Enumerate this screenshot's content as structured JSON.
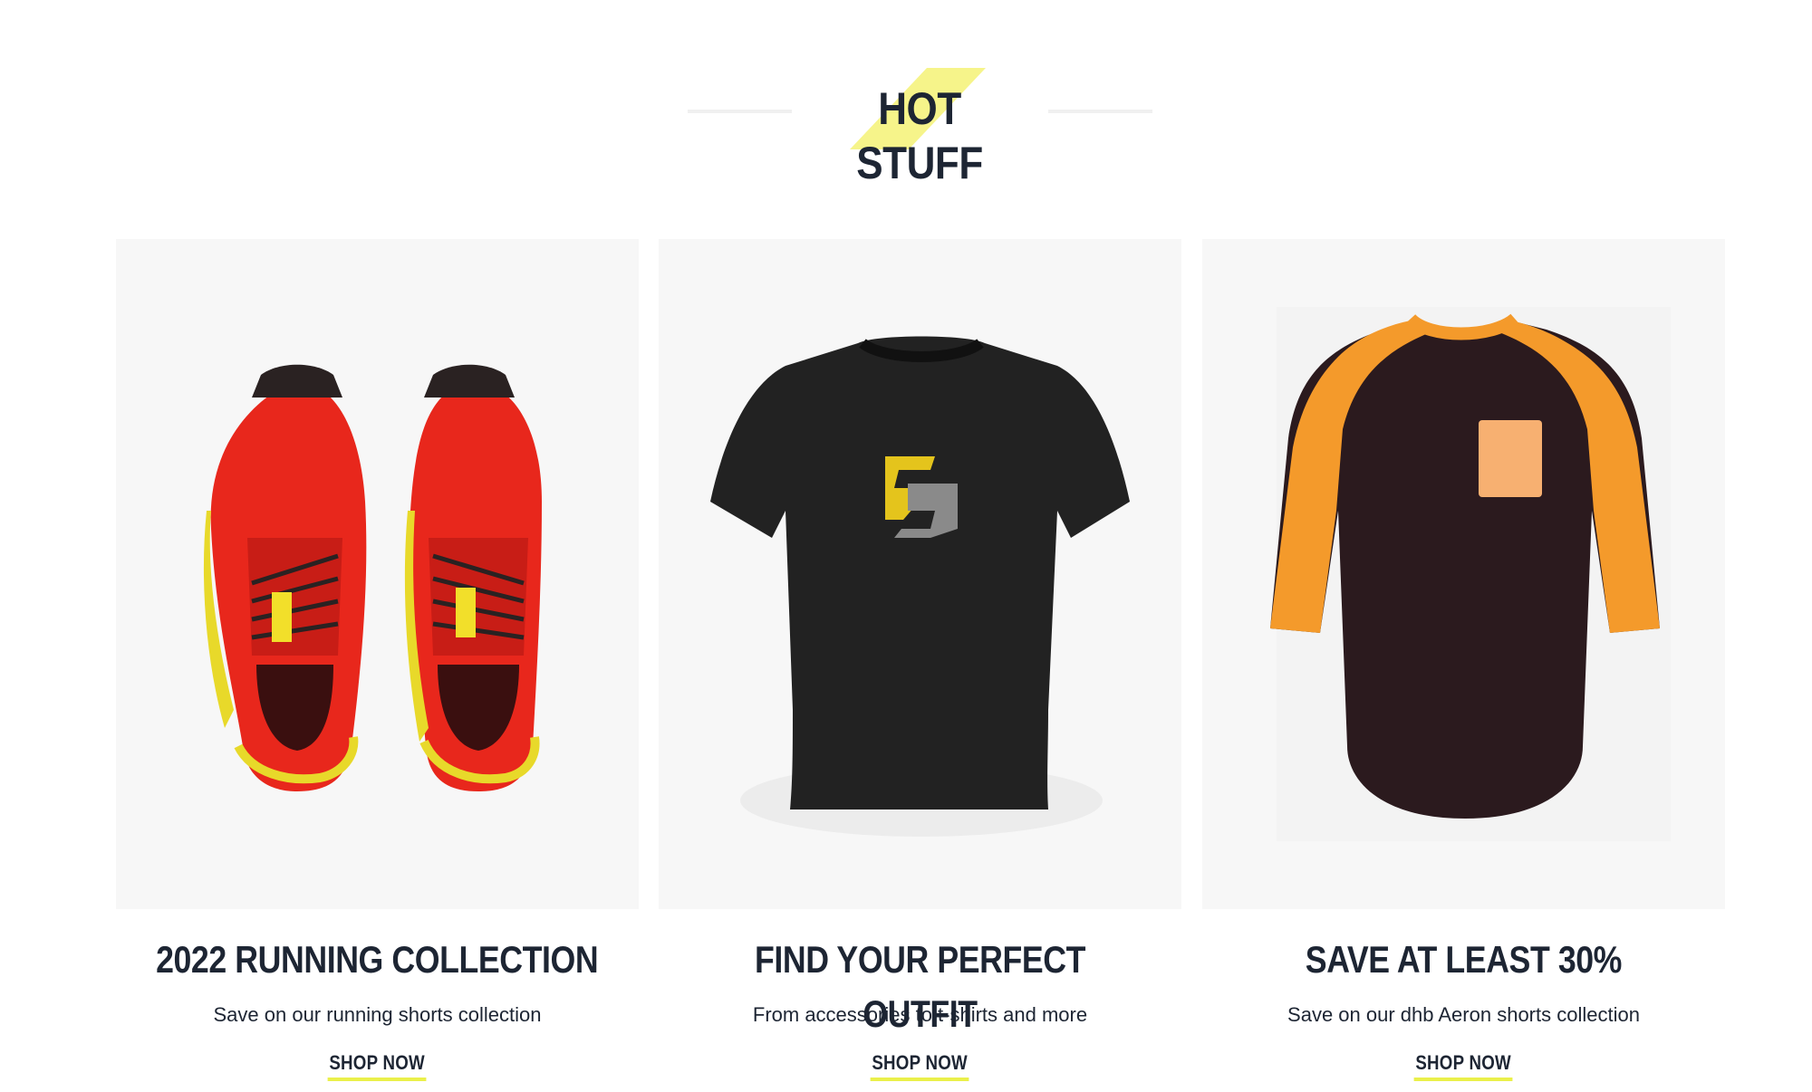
{
  "section": {
    "title": "HOT STUFF",
    "accent_color": "#f6f48a"
  },
  "cards": [
    {
      "title": "2022 RUNNING COLLECTION",
      "subtitle": "Save on our running shorts collection",
      "cta": "SHOP NOW",
      "image": "red-running-shoes"
    },
    {
      "title": "FIND YOUR PERFECT OUTFIT",
      "subtitle": "From accessories to t-shirts and more",
      "cta": "SHOP NOW",
      "image": "black-tshirt-logo"
    },
    {
      "title": "SAVE AT LEAST 30%",
      "subtitle": "Save on our dhb Aeron shorts collection",
      "cta": "SHOP NOW",
      "image": "orange-black-raglan-shirt"
    }
  ],
  "colors": {
    "text": "#1d2533",
    "card_bg": "#f7f7f7",
    "underline": "#eaf04a"
  }
}
